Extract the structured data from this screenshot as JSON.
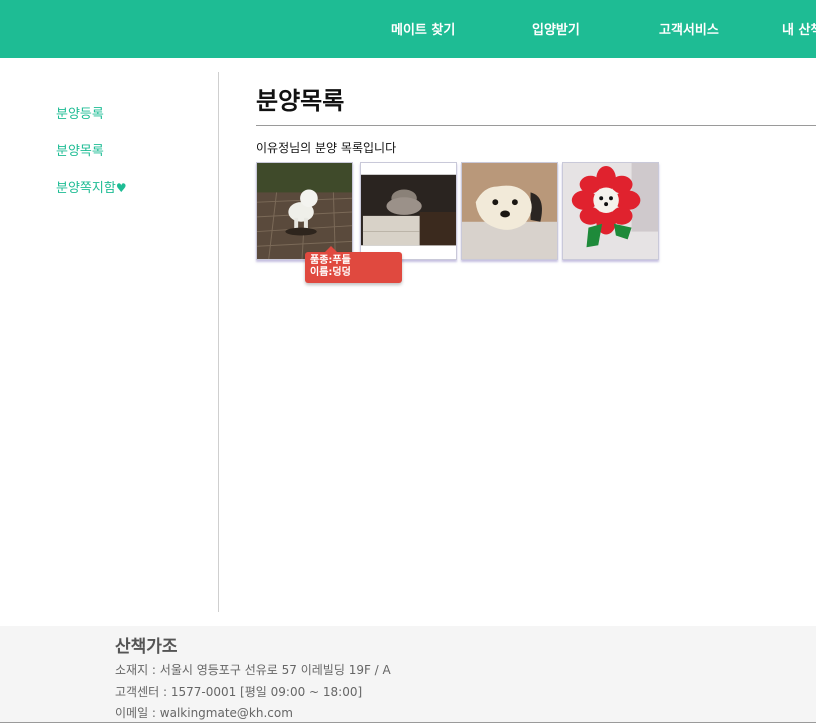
{
  "nav": {
    "items": [
      {
        "label": "메이트 찾기"
      },
      {
        "label": "입양받기"
      },
      {
        "label": "고객서비스"
      },
      {
        "label": "내 산책"
      }
    ]
  },
  "sidebar": {
    "items": [
      {
        "label": "분양등록"
      },
      {
        "label": "분양목록"
      },
      {
        "label": "분양쪽지함",
        "icon": "heart-icon"
      }
    ]
  },
  "main": {
    "title": "분양목록",
    "subtitle": "이유정님의 분양 목록입니다",
    "pets": [
      {
        "image": "white-dog-on-brick-path"
      },
      {
        "image": "fluffy-cat-on-lace-table"
      },
      {
        "image": "white-dog-portrait"
      },
      {
        "image": "dog-in-red-flower-costume"
      }
    ],
    "tooltip": {
      "breed": "품종:푸들",
      "name": "이름:덩덩"
    }
  },
  "footer": {
    "brand": "산책가조",
    "address": "소재지 : 서울시 영등포구 선유로 57 이레빌딩 19F / A",
    "phone": "고객센터 : 1577-0001 [평일 09:00 ~ 18:00]",
    "email": "이메일 : walkingmate@kh.com"
  },
  "colors": {
    "brand": "#1ebc94",
    "tooltip": "#e0493f",
    "footer_bg": "#f5f5f5"
  }
}
